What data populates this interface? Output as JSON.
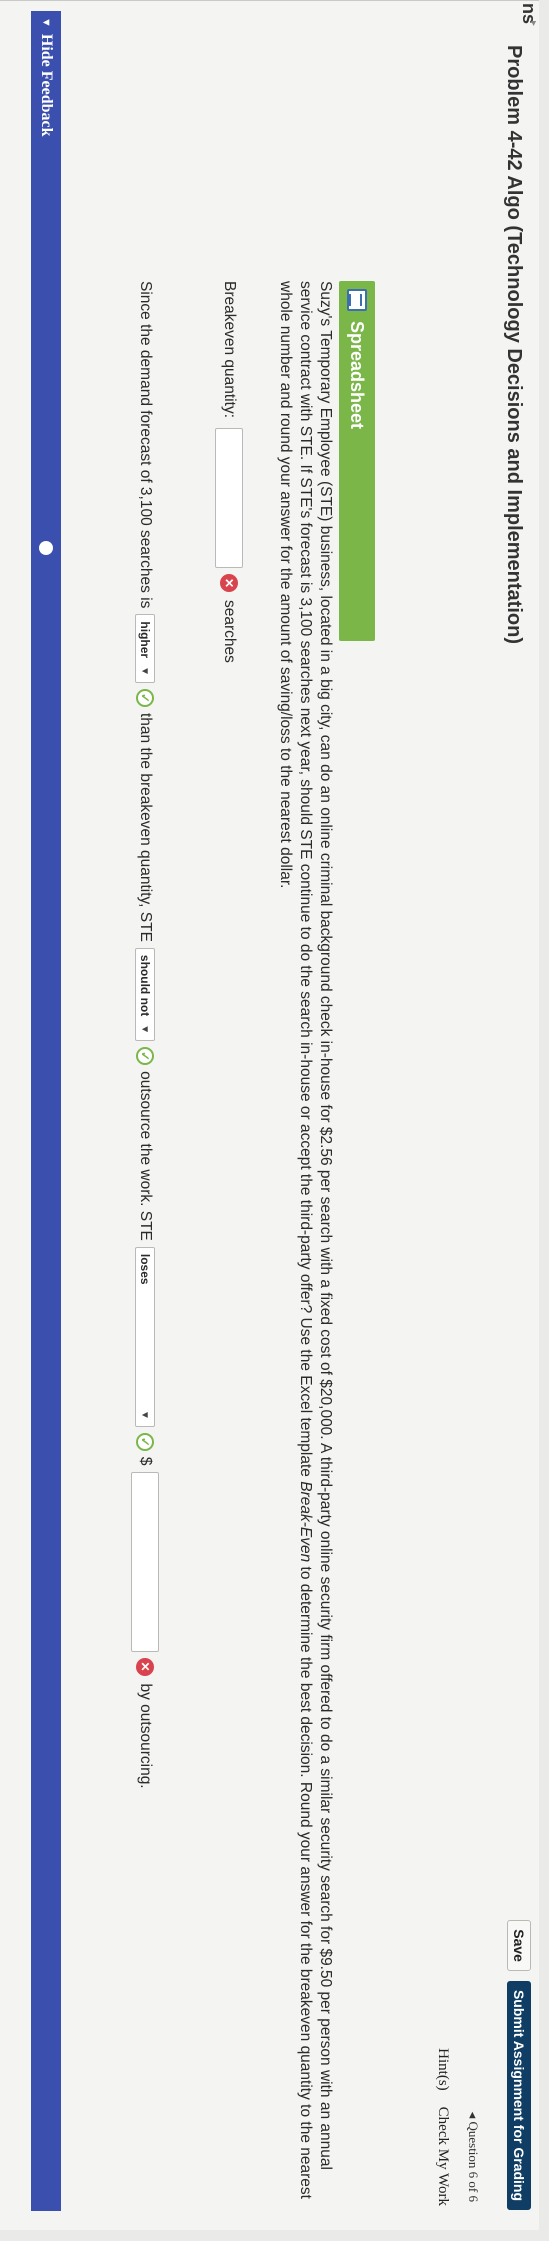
{
  "header": {
    "nav_fragment": "ns",
    "title": "Problem 4-42 Algo (Technology Decisions and Implementation)",
    "save_label": "Save",
    "submit_label": "Submit Assignment for Grading",
    "question_nav": "◂ Question 6 of 6",
    "hints_label": "Hint(s)",
    "check_label": "Check My Work"
  },
  "problem": {
    "spreadsheet_label": "Spreadsheet",
    "paragraph_main": "Suzy's Temporary Employee (STE) business, located in a big city, can do an online criminal background check in-house for $2.56 per search with a fixed cost of $20,000. A third-party online security firm offered to do a similar security search for $9.50 per person with an annual service contract with STE. If STE's forecast is 3,100 searches next year, should STE continue to do the search in-house or accept the third-party offer? Use the Excel template ",
    "paragraph_italic": "Break-Even",
    "paragraph_tail": " to determine the best decision. Round your answer for the breakeven quantity to the nearest whole number and round your answer for the amount of saving/loss to the nearest dollar."
  },
  "breakeven": {
    "label": "Breakeven quantity:",
    "value": "",
    "unit": "searches"
  },
  "decision": {
    "prefix": "Since the demand forecast of 3,100 searches is",
    "select1_value": "higher",
    "mid1": "than the breakeven quantity, STE",
    "select2_value": "should not",
    "mid2": "outsource the work. STE",
    "select3_value": "loses",
    "currency": "$",
    "amount_value": "",
    "suffix": "by outsourcing."
  },
  "feedback": {
    "label": "Hide Feedback"
  },
  "icons": {
    "check_color": "#7ab648",
    "x_color": "#d9434e",
    "accent": "#7ab648",
    "feedback_bar": "#3a4fae",
    "submit_bg": "#0f3d63"
  }
}
